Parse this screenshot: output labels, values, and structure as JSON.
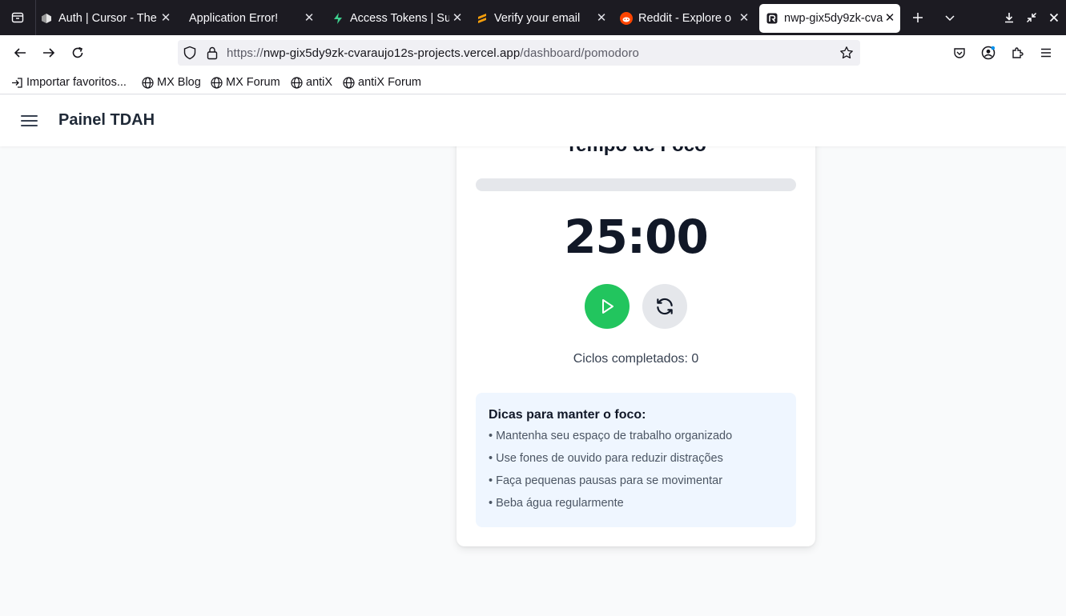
{
  "browser": {
    "tabs": [
      {
        "title": "Auth | Cursor - The",
        "favicon": "cursor-icon",
        "active": false
      },
      {
        "title": "Application Error!",
        "favicon": "none",
        "active": false
      },
      {
        "title": "Access Tokens | Su",
        "favicon": "supabase-icon",
        "active": false
      },
      {
        "title": "Verify your email",
        "favicon": "sublime-icon",
        "active": false
      },
      {
        "title": "Reddit - Explore o",
        "favicon": "reddit-icon",
        "active": false
      },
      {
        "title": "nwp-gix5dy9zk-cva",
        "favicon": "replit-icon",
        "active": true
      }
    ],
    "url": {
      "scheme": "https://",
      "host": "nwp-gix5dy9zk-cvaraujo12s-projects.vercel.app",
      "path": "/dashboard/pomodoro"
    },
    "bookmarks": [
      {
        "label": "Importar favoritos...",
        "icon": "import-icon"
      },
      {
        "label": "MX Blog",
        "icon": "globe-icon"
      },
      {
        "label": "MX Forum",
        "icon": "globe-icon"
      },
      {
        "label": "antiX",
        "icon": "globe-icon"
      },
      {
        "label": "antiX Forum",
        "icon": "globe-icon"
      }
    ]
  },
  "app": {
    "title": "Painel TDAH",
    "colors": {
      "accent": "#22c55e",
      "tips_bg": "#eff6ff",
      "track": "#e5e7eb"
    }
  },
  "pomodoro": {
    "mode_title": "Tempo de Foco",
    "progress": 0,
    "time": "25:00",
    "cycles_text": "Ciclos completados: 0",
    "tips": {
      "title": "Dicas para manter o foco:",
      "items": [
        "• Mantenha seu espaço de trabalho organizado",
        "• Use fones de ouvido para reduzir distrações",
        "• Faça pequenas pausas para se movimentar",
        "• Beba água regularmente"
      ]
    }
  }
}
